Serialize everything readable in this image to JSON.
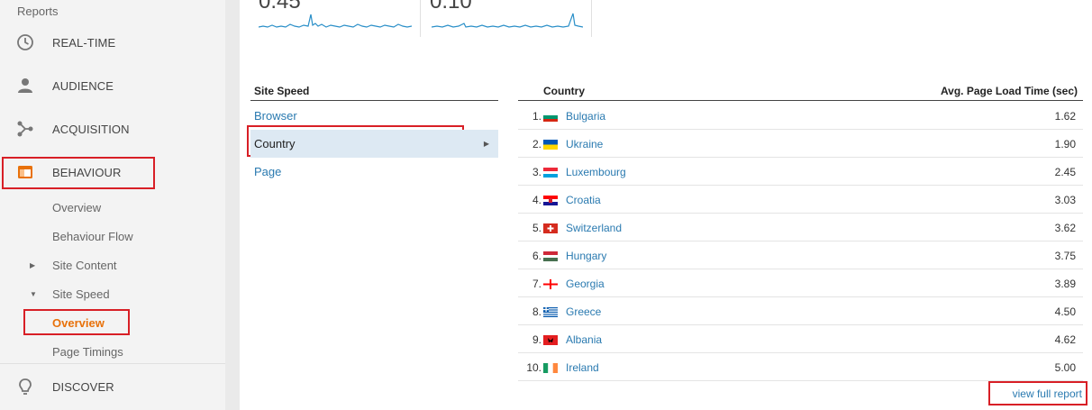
{
  "sidebar": {
    "reports_label": "Reports",
    "realtime": "REAL-TIME",
    "audience": "AUDIENCE",
    "acquisition": "ACQUISITION",
    "behaviour": "BEHAVIOUR",
    "overview": "Overview",
    "behaviour_flow": "Behaviour Flow",
    "site_content": "Site Content",
    "site_speed": "Site Speed",
    "site_speed_overview": "Overview",
    "page_timings": "Page Timings",
    "discover": "DISCOVER"
  },
  "sparklines": {
    "card1_value": "0.45",
    "card2_value": "0.10",
    "color": "#2a8fc8"
  },
  "dimensions": {
    "header": "Site Speed",
    "items": [
      "Browser",
      "Country",
      "Page"
    ]
  },
  "table": {
    "col_country": "Country",
    "col_metric": "Avg. Page Load Time (sec)",
    "rows": [
      {
        "rank": "1.",
        "country": "Bulgaria",
        "value": "1.62"
      },
      {
        "rank": "2.",
        "country": "Ukraine",
        "value": "1.90"
      },
      {
        "rank": "3.",
        "country": "Luxembourg",
        "value": "2.45"
      },
      {
        "rank": "4.",
        "country": "Croatia",
        "value": "3.03"
      },
      {
        "rank": "5.",
        "country": "Switzerland",
        "value": "3.62"
      },
      {
        "rank": "6.",
        "country": "Hungary",
        "value": "3.75"
      },
      {
        "rank": "7.",
        "country": "Georgia",
        "value": "3.89"
      },
      {
        "rank": "8.",
        "country": "Greece",
        "value": "4.50"
      },
      {
        "rank": "9.",
        "country": "Albania",
        "value": "4.62"
      },
      {
        "rank": "10.",
        "country": "Ireland",
        "value": "5.00"
      }
    ],
    "view_full_report": "view full report"
  },
  "colors": {
    "accent_orange": "#e8710a",
    "link_blue": "#2a7ab0",
    "highlight_red": "#d81f26"
  }
}
